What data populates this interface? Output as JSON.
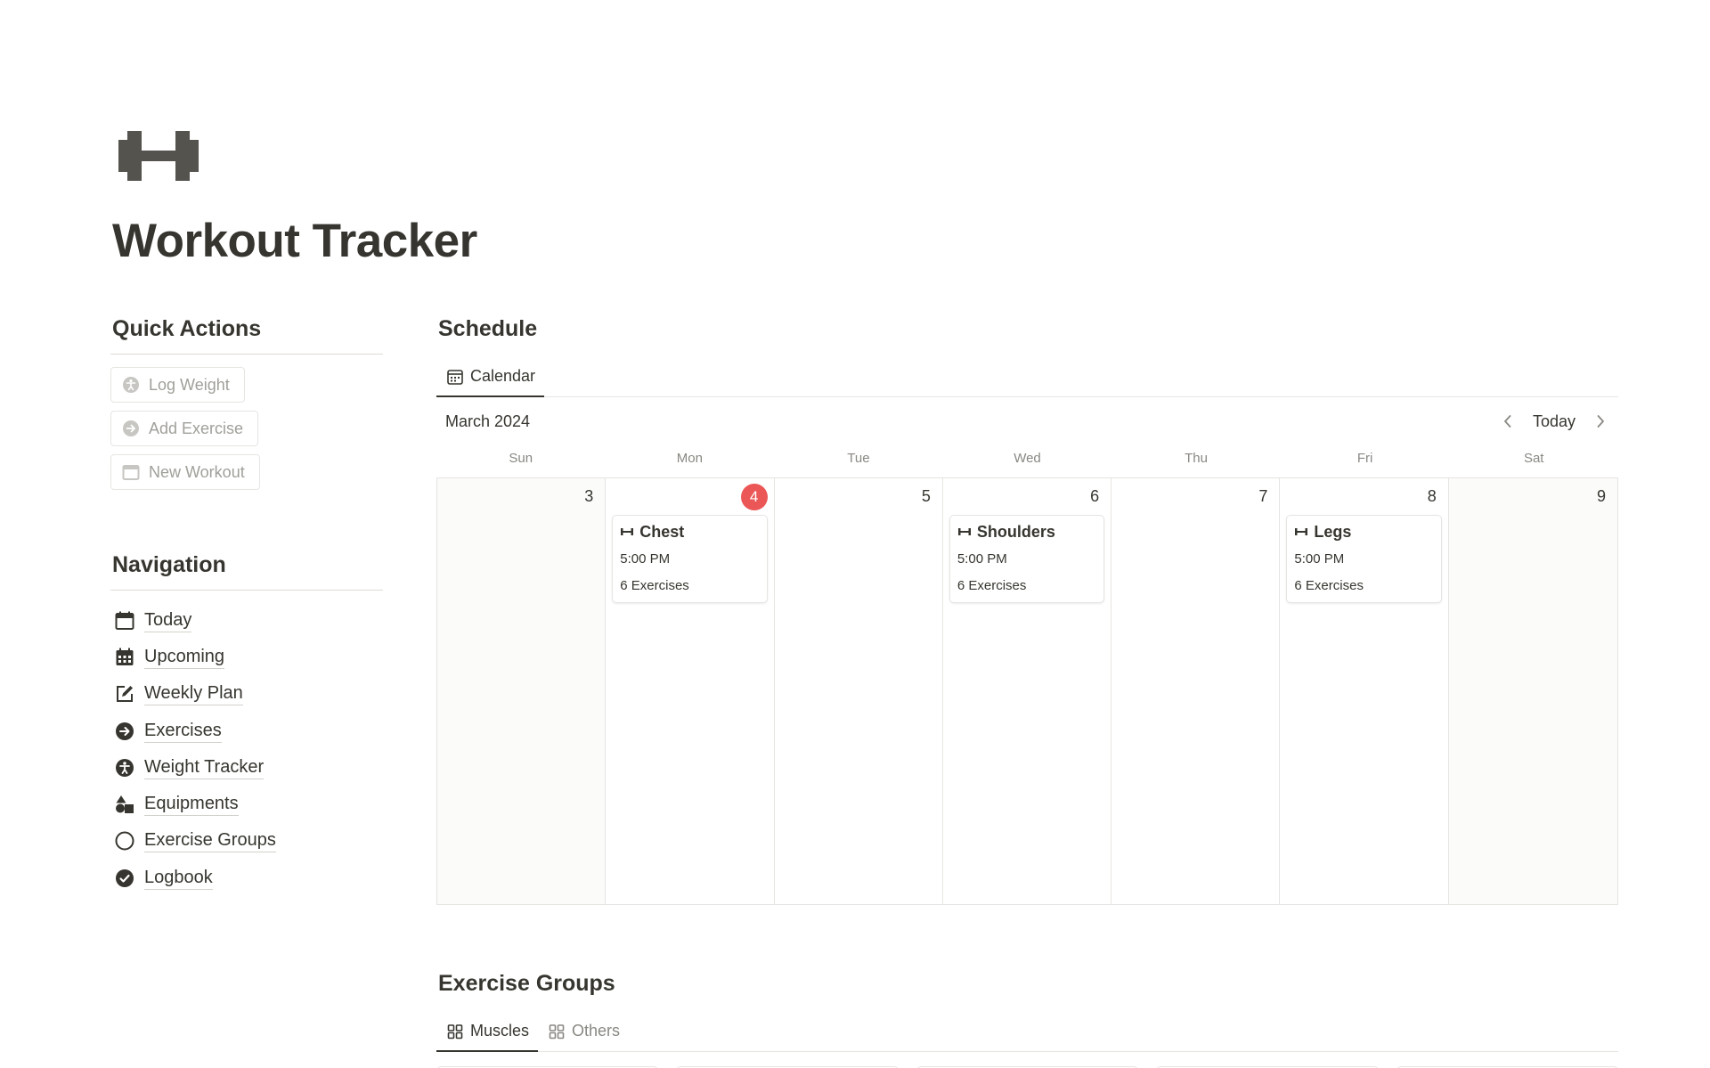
{
  "page": {
    "icon": "dumbbell-icon",
    "title": "Workout Tracker"
  },
  "quick_actions": {
    "heading": "Quick Actions",
    "items": [
      {
        "label": "Log Weight",
        "icon": "accessibility-icon"
      },
      {
        "label": "Add Exercise",
        "icon": "arrow-circle-right-icon"
      },
      {
        "label": "New Workout",
        "icon": "calendar-icon"
      }
    ]
  },
  "navigation": {
    "heading": "Navigation",
    "items": [
      {
        "label": "Today",
        "icon": "calendar-icon"
      },
      {
        "label": "Upcoming",
        "icon": "calendar-grid-icon"
      },
      {
        "label": "Weekly Plan",
        "icon": "edit-icon"
      },
      {
        "label": "Exercises",
        "icon": "arrow-circle-right-icon"
      },
      {
        "label": "Weight Tracker",
        "icon": "accessibility-icon"
      },
      {
        "label": "Equipments",
        "icon": "shapes-icon"
      },
      {
        "label": "Exercise Groups",
        "icon": "circle-outline-icon"
      },
      {
        "label": "Logbook",
        "icon": "check-circle-icon"
      }
    ]
  },
  "schedule": {
    "heading": "Schedule",
    "tabs": [
      {
        "label": "Calendar",
        "icon": "calendar-icon",
        "active": true
      }
    ],
    "month": "March 2024",
    "today_label": "Today",
    "weekdays": [
      "Sun",
      "Mon",
      "Tue",
      "Wed",
      "Thu",
      "Fri",
      "Sat"
    ],
    "days": [
      {
        "num": "3",
        "weekend": true,
        "today": false,
        "event": null
      },
      {
        "num": "4",
        "weekend": false,
        "today": true,
        "event": {
          "title": "Chest",
          "time": "5:00 PM",
          "exercises": "6 Exercises"
        }
      },
      {
        "num": "5",
        "weekend": false,
        "today": false,
        "event": null
      },
      {
        "num": "6",
        "weekend": false,
        "today": false,
        "event": {
          "title": "Shoulders",
          "time": "5:00 PM",
          "exercises": "6 Exercises"
        }
      },
      {
        "num": "7",
        "weekend": false,
        "today": false,
        "event": null
      },
      {
        "num": "8",
        "weekend": false,
        "today": false,
        "event": {
          "title": "Legs",
          "time": "5:00 PM",
          "exercises": "6 Exercises"
        }
      },
      {
        "num": "9",
        "weekend": true,
        "today": false,
        "event": null
      }
    ],
    "accent_color": "#eb5757"
  },
  "exercise_groups": {
    "heading": "Exercise Groups",
    "tabs": [
      {
        "label": "Muscles",
        "icon": "gallery-icon",
        "active": true
      },
      {
        "label": "Others",
        "icon": "gallery-icon",
        "active": false
      }
    ]
  }
}
